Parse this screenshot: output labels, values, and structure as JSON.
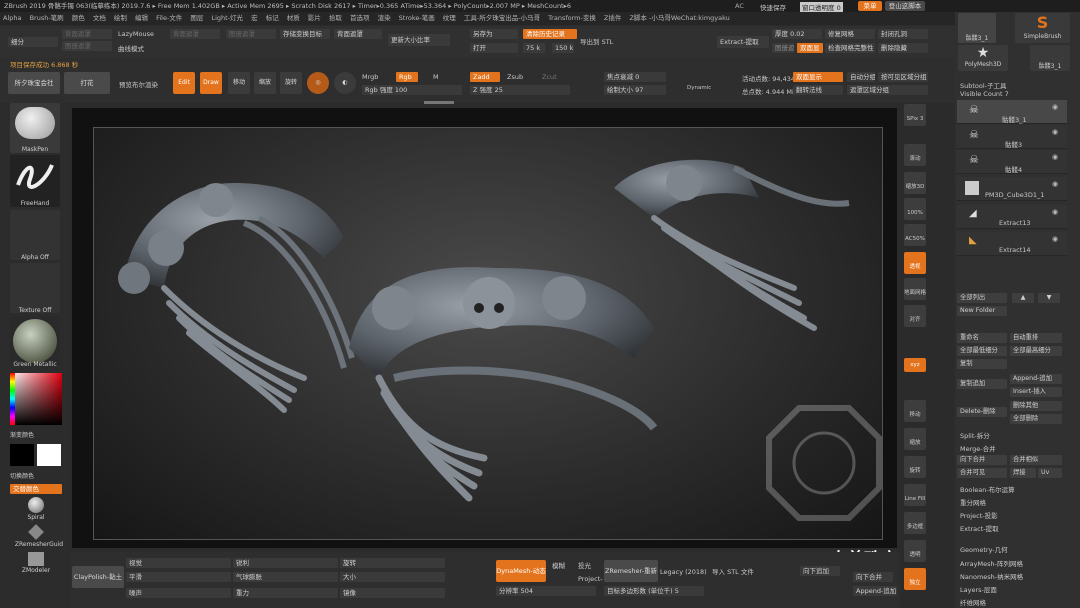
{
  "titlebar": "ZBrush 2019  骨骼手镯 063(临摹练本) 2019.7.6  ▸ Free Mem 1.402GB ▸ Active Mem 2695 ▸ Scratch Disk 2617 ▸ Timer▸0.365 ATime▸53.364 ▸ PolyCount▸2.007 MP ▸ MeshCount▸6",
  "title_right": {
    "ac": "AC",
    "quickssave": "快速保存",
    "transparency": "窗口透明度 0",
    "menu": "菜单",
    "login": "登山这脚本"
  },
  "menus": [
    "Alpha",
    "Brush-笔刷",
    "颜色",
    "文档",
    "绘制",
    "编辑",
    "File-文件",
    "图层",
    "Light-灯光",
    "宏",
    "标记",
    "材质",
    "影片",
    "拾取",
    "首选项",
    "渲染",
    "Stroke-笔画",
    "纹理",
    "工具-所夕珠宝出品-小马哥",
    "Transform-变换",
    "Z插件",
    "Z脚本 -小马哥WeChat:kimgyaku"
  ],
  "topbar": {
    "xifen": "细分",
    "lazymouse": "LazyMouse",
    "quxianmoshi": "曲线模式",
    "cunchu": "存储变换目标",
    "beimian": "背面遮罩",
    "gengxin": "更新大小比率",
    "lingcun": "另存为",
    "dakai": "打开",
    "lishi": "清除历史记录",
    "v75": "75 k",
    "v150": "150 k",
    "daochu": "导出到 STL",
    "extract": "Extract-提取",
    "houdu": "厚度 0.02",
    "shuangmian": "双面显",
    "jiancha": "检查网格完整性",
    "xiufu": "修复网格",
    "fengbi": "封闭孔洞",
    "shanchu": "删除隐藏",
    "ghost1": "背面遮罩",
    "ghost2": "图册遮罩"
  },
  "row3": {
    "project": "项目保存成功 6.868 秒",
    "zhubao": "所夕珠宝会社",
    "dahua": "打花",
    "yulan": "预览布尔渲染",
    "mrgb": "Mrgb",
    "rgb": "Rgb",
    "m": "M",
    "rgbstr": "Rgb 强度 100",
    "zadd": "Zadd",
    "zsub": "Zsub",
    "zcut": "Zcut",
    "zintensity": "Z 强度 25",
    "focal": "焦点衰减 0",
    "drawsize": "绘制大小 97",
    "dynamic": "Dynamic",
    "activepoints": "活动点数: 94,434",
    "totalpoints": "总点数: 4.944 Mil",
    "doublesided": "双面显示",
    "turnoff": "翻转法线",
    "autogroups": "自动分组",
    "grouphidden": "按可见区域分组",
    "polygroup": "遮罩区域分组",
    "icons": [
      "Edit",
      "Draw",
      "移动",
      "缩放",
      "旋转"
    ]
  },
  "left": {
    "brush": "MaskPen",
    "stroke": "FreeHand",
    "alpha": "Alpha Off",
    "texture": "Texture Off",
    "material": "Green Metallic",
    "maincolor": "渐变颜色",
    "switch": "切换颜色",
    "alternate": "交替颜色",
    "spiral": "Spiral",
    "zrem": "ZRemesherGuid",
    "zmod": "ZModeler"
  },
  "right_shelf": [
    "SPix 3",
    "滚动",
    "缩放3D",
    "100%",
    "AC50%",
    "透视",
    "地面网格",
    "对齐",
    "xyz",
    "移动",
    "缩放",
    "旋转",
    "Line Fill",
    "多边框",
    "透明",
    "独立"
  ],
  "subtool": {
    "header": "Subtool-子工具",
    "visible": "Visible Count 7",
    "thumbs": [
      "骷髅3_1",
      "SimpleBrush",
      "PolyMesh3D",
      "骷髅3_1"
    ],
    "items": [
      "骷髅3_1",
      "骷髅3",
      "骷髅4",
      "PM3D_Cube3D1_1",
      "Extract13",
      "Extract14"
    ],
    "buttons": [
      "全部列出",
      "New Folder",
      "重命名",
      "自动重排",
      "全部最低细分",
      "全部最高细分",
      "复制",
      "复制追加",
      "Append-追加",
      "Insert-插入",
      "Delete-删除",
      "删除其他",
      "全部删除",
      "Split-拆分",
      "Merge-合并",
      "向下合并",
      "合并相似",
      "合并可见",
      "焊接",
      "Uv",
      "Boolean-布尔运算",
      "重分网格",
      "Project-投影",
      "Extract-提取",
      "Geometry-几何",
      "ArrayMesh-阵列网格",
      "Nanomesh-纳米网格",
      "Layers-层面",
      "纤维网格"
    ]
  },
  "bottom": {
    "brushname": "ClayPolish-黏土",
    "b1": "视觉",
    "b2": "平滑",
    "b3": "噪声",
    "b4": "锐利",
    "b5": "压强",
    "b6": "气球膨胀",
    "b7": "重力",
    "b8": "旋转",
    "b9": "大小",
    "b10": "镜像",
    "dynamesh": "DynaMesh-动态",
    "blur": "模糊",
    "proj": "投光",
    "resolution": "分辨率 504",
    "project": "Project-",
    "zrem": "ZRemesher-重新",
    "legacy": "Legacy (2018)",
    "target": "目标多边形数 (单位千) 5",
    "stl": "导入 STL 文件",
    "down": "向下合并",
    "append": "Append-追加",
    "weibo": "向下追加"
  },
  "watermark": "大曾珠宝工作室"
}
